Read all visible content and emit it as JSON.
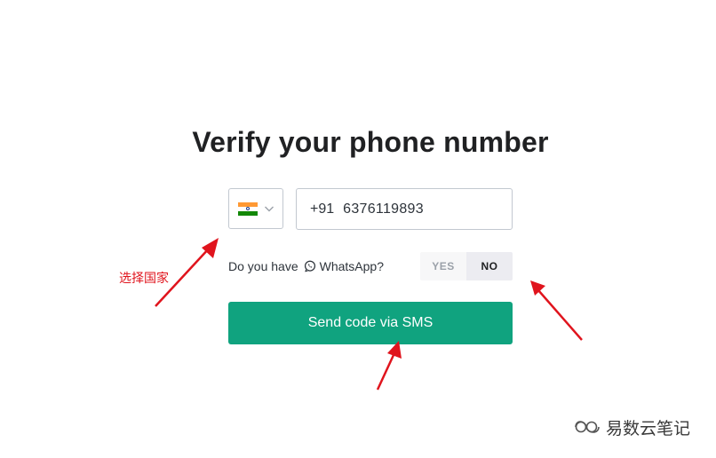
{
  "page": {
    "title": "Verify your phone number"
  },
  "country_select": {
    "flag": "india-flag",
    "flag_colors": [
      "#ff9933",
      "#ffffff",
      "#138808"
    ]
  },
  "phone": {
    "country_code": "+91",
    "number": "6376119893"
  },
  "whatsapp": {
    "question_prefix": "Do you have",
    "app_name": "WhatsApp?",
    "icon": "whatsapp-icon",
    "yes_label": "YES",
    "no_label": "NO",
    "selected": "NO"
  },
  "send_button": {
    "label": "Send code via SMS",
    "color": "#10a37f"
  },
  "annotations": {
    "country_note": "选择国家",
    "color": "#e0141d"
  },
  "watermark": {
    "text": "易数云笔记"
  }
}
